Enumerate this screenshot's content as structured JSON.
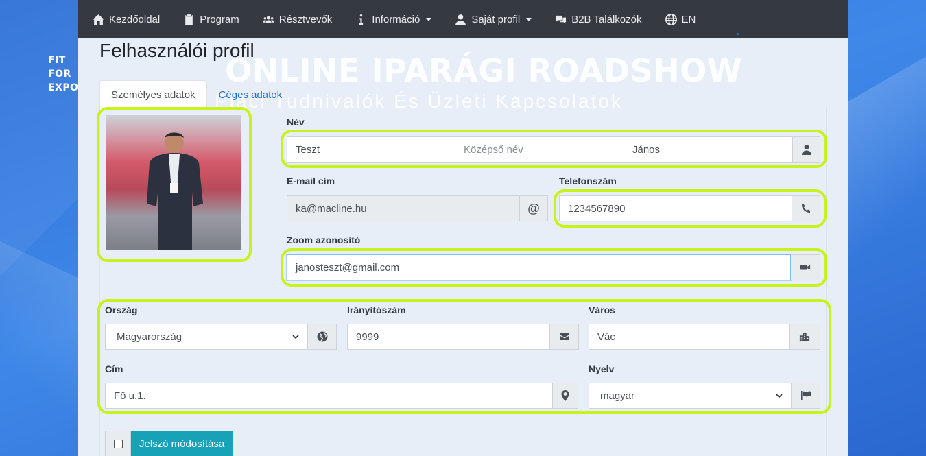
{
  "nav": {
    "items": [
      {
        "label": "Kezdőoldal",
        "icon": "home-icon"
      },
      {
        "label": "Program",
        "icon": "clipboard-icon"
      },
      {
        "label": "Résztvevők",
        "icon": "users-icon"
      },
      {
        "label": "Információ",
        "icon": "info-icon",
        "dropdown": true
      },
      {
        "label": "Saját profil",
        "icon": "user-icon",
        "dropdown": true
      },
      {
        "label": "B2B Találkozók",
        "icon": "comments-icon"
      },
      {
        "label": "EN",
        "icon": "globe-icon"
      }
    ]
  },
  "logo": {
    "line1": "FIT",
    "line2": "FOR",
    "line3": "EXPORT"
  },
  "banner": {
    "title": "ONLINE IPARÁGI ROADSHOW",
    "subtitle": "Piaci Tudnivalók És Üzleti Kapcsolatok"
  },
  "page": {
    "title": "Felhasználói profil"
  },
  "tabs": [
    {
      "label": "Személyes adatok",
      "active": true
    },
    {
      "label": "Céges adatok",
      "active": false
    }
  ],
  "form": {
    "name_label": "Név",
    "last_name": "Teszt",
    "middle_name_placeholder": "Középső név",
    "first_name": "János",
    "email_label": "E-mail cím",
    "email": "ka@macline.hu",
    "phone_label": "Telefonszám",
    "phone": "1234567890",
    "zoom_label": "Zoom azonosító",
    "zoom": "janosteszt@gmail.com",
    "country_label": "Ország",
    "country": "Magyarország",
    "zip_label": "Irányítószám",
    "zip": "9999",
    "city_label": "Város",
    "city": "Vác",
    "address_label": "Cím",
    "address": "Fő u.1.",
    "language_label": "Nyelv",
    "language": "magyar"
  },
  "password_button": "Jelszó módosítása",
  "colors": {
    "navbar": "#343a40",
    "highlight": "#c8f21b",
    "button": "#17a2b8",
    "background": "#2f74d8"
  }
}
